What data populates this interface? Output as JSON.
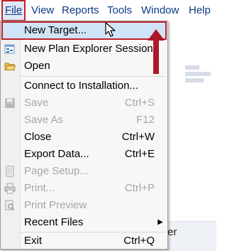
{
  "menubar": {
    "items": [
      {
        "label": "File"
      },
      {
        "label": "View"
      },
      {
        "label": "Reports"
      },
      {
        "label": "Tools"
      },
      {
        "label": "Window"
      },
      {
        "label": "Help"
      }
    ]
  },
  "file_menu": {
    "items": [
      {
        "label": "New Target...",
        "shortcut": "",
        "enabled": true
      },
      {
        "label": "New Plan Explorer Session",
        "shortcut": "",
        "enabled": true
      },
      {
        "label": "Open",
        "shortcut": "",
        "enabled": true
      },
      {
        "label": "Connect to Installation...",
        "shortcut": "",
        "enabled": true
      },
      {
        "label": "Save",
        "shortcut": "Ctrl+S",
        "enabled": false
      },
      {
        "label": "Save As",
        "shortcut": "F12",
        "enabled": false
      },
      {
        "label": "Close",
        "shortcut": "Ctrl+W",
        "enabled": true
      },
      {
        "label": "Export Data...",
        "shortcut": "Ctrl+E",
        "enabled": true
      },
      {
        "label": "Page Setup...",
        "shortcut": "",
        "enabled": false
      },
      {
        "label": "Print...",
        "shortcut": "Ctrl+P",
        "enabled": false
      },
      {
        "label": "Print Preview",
        "shortcut": "",
        "enabled": false
      },
      {
        "label": "Recent Files",
        "shortcut": "",
        "enabled": true
      },
      {
        "label": "Exit",
        "shortcut": "Ctrl+Q",
        "enabled": true
      }
    ]
  },
  "background": {
    "tab_fragment": "er"
  },
  "colors": {
    "highlight_border": "#c0202a",
    "highlight_fill": "#cfe4f7",
    "annotation_arrow": "#b0182a",
    "disabled_text": "#a6a6a6",
    "menubar_text": "#0b3a82"
  }
}
